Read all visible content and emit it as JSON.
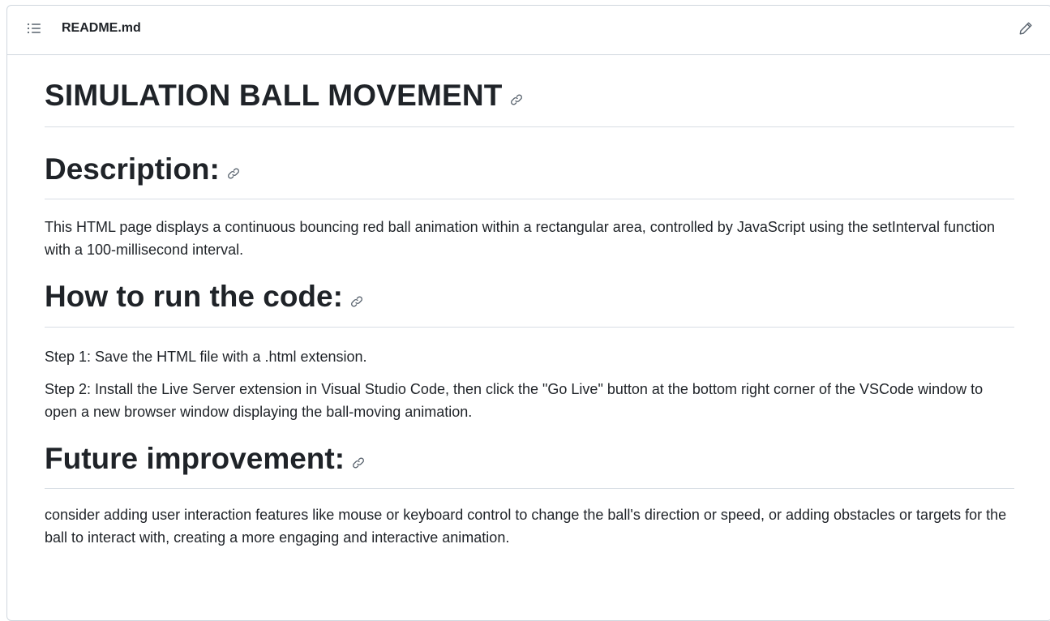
{
  "header": {
    "file_name": "README.md",
    "outline_icon": "list-unordered-icon",
    "edit_icon": "pencil-icon"
  },
  "readme": {
    "title": "SIMULATION BALL MOVEMENT",
    "sections": [
      {
        "heading": "Description:",
        "paragraphs": [
          "This HTML page displays a continuous bouncing red ball animation within a rectangular area, controlled by JavaScript using the setInterval function with a 100-millisecond interval."
        ]
      },
      {
        "heading": "How to run the code:",
        "paragraphs": [
          "Step 1: Save the HTML file with a .html extension.",
          "Step 2: Install the Live Server extension in Visual Studio Code, then click the \"Go Live\" button at the bottom right corner of the VSCode window to open a new browser window displaying the ball-moving animation."
        ]
      },
      {
        "heading": "Future improvement:",
        "paragraphs": [
          "consider adding user interaction features like mouse or keyboard control to change the ball's direction or speed, or adding obstacles or targets for the ball to interact with, creating a more engaging and interactive animation."
        ]
      }
    ],
    "anchor_icon": "link-icon"
  },
  "colors": {
    "text": "#1f2328",
    "border": "#d0d7de",
    "icon": "#59636e"
  }
}
